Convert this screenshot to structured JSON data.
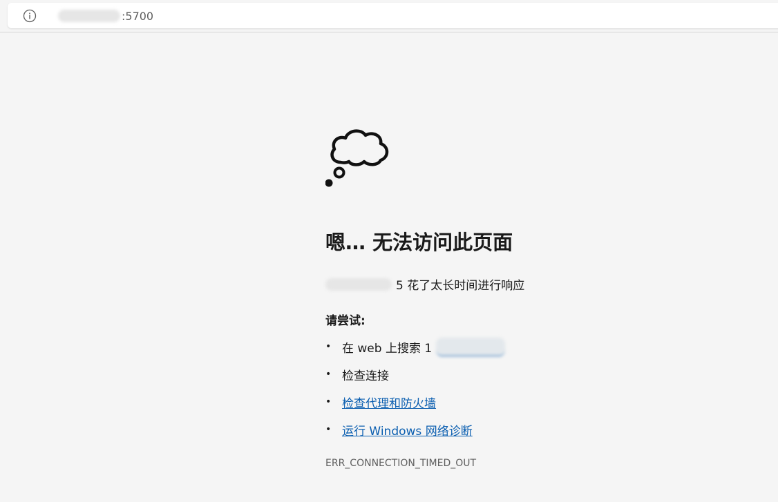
{
  "address_bar": {
    "url_visible": ":5700"
  },
  "error_page": {
    "title": "嗯… 无法访问此页面",
    "description": "5 花了太长时间进行响应",
    "try_heading": "请尝试:",
    "suggestions": [
      {
        "text": "在 web 上搜索 1",
        "is_link": false
      },
      {
        "text": "检查连接",
        "is_link": false
      },
      {
        "text": "检查代理和防火墙",
        "is_link": true
      },
      {
        "text": "运行 Windows 网络诊断",
        "is_link": true
      }
    ],
    "error_code": "ERR_CONNECTION_TIMED_OUT"
  },
  "icons": {
    "info": "info-icon",
    "error_illustration": "thought-cloud-icon"
  },
  "colors": {
    "background": "#f5f5f5",
    "link": "#0a5eb0",
    "muted_text": "#5f5f5f"
  }
}
